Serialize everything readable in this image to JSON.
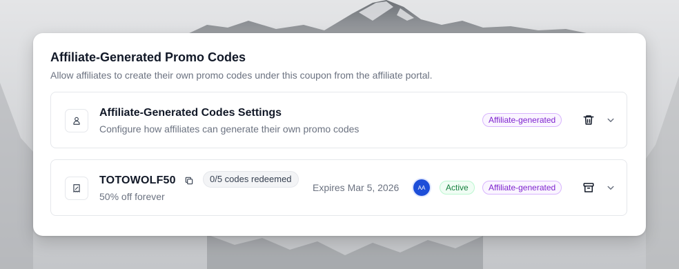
{
  "section": {
    "title": "Affiliate-Generated Promo Codes",
    "subtitle": "Allow affiliates to create their own promo codes under this coupon from the affiliate portal."
  },
  "settings_panel": {
    "icon": "user-icon",
    "title": "Affiliate-Generated Codes Settings",
    "description": "Configure how affiliates can generate their own promo codes",
    "badge": "Affiliate-generated",
    "action_icon": "trash-icon",
    "expand_icon": "chevron-down-icon"
  },
  "promo_code": {
    "icon": "receipt-icon",
    "code": "TOTOWOLF50",
    "copy_icon": "copy-icon",
    "redeemed": "0/5 codes redeemed",
    "discount": "50% off forever",
    "expires": "Expires Mar 5, 2026",
    "avatar_initials": "AA",
    "status": "Active",
    "badge": "Affiliate-generated",
    "action_icon": "archive-icon",
    "expand_icon": "chevron-down-icon"
  },
  "colors": {
    "purple_badge_text": "#7e22ce",
    "green_badge_text": "#15803d",
    "avatar_bg": "#1d4ed8"
  }
}
